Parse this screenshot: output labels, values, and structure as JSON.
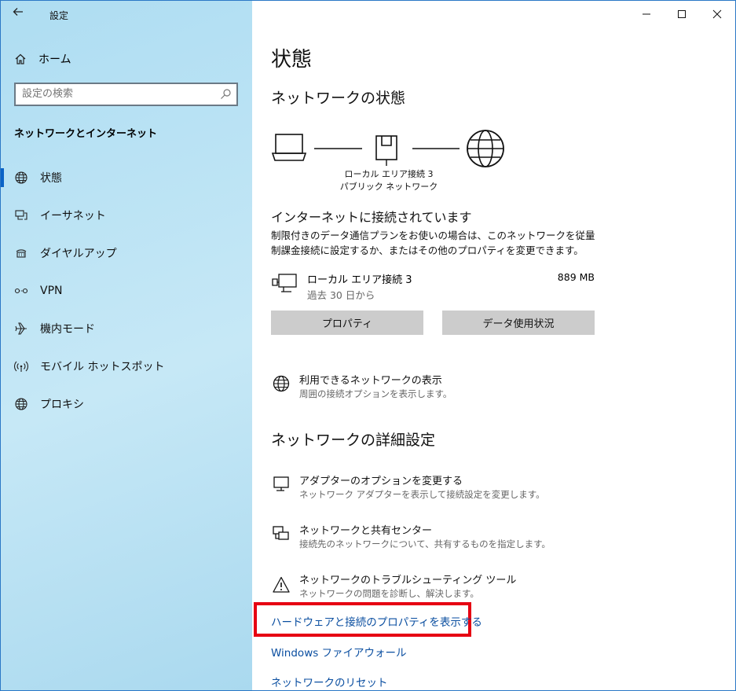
{
  "window": {
    "title": "設定"
  },
  "sidebar": {
    "home_label": "ホーム",
    "search_placeholder": "設定の検索",
    "section_title": "ネットワークとインターネット",
    "items": [
      {
        "label": "状態",
        "icon": "globe-icon",
        "selected": true
      },
      {
        "label": "イーサネット",
        "icon": "ethernet-icon"
      },
      {
        "label": "ダイヤルアップ",
        "icon": "dialup-icon"
      },
      {
        "label": "VPN",
        "icon": "vpn-icon"
      },
      {
        "label": "機内モード",
        "icon": "airplane-icon"
      },
      {
        "label": "モバイル ホットスポット",
        "icon": "hotspot-icon"
      },
      {
        "label": "プロキシ",
        "icon": "globe-icon"
      }
    ]
  },
  "main": {
    "page_title": "状態",
    "network_status_heading": "ネットワークの状態",
    "network_name": "ローカル エリア接続 3",
    "network_type": "パブリック ネットワーク",
    "connected_heading": "インターネットに接続されています",
    "connected_desc": "制限付きのデータ通信プランをお使いの場合は、このネットワークを従量制課金接続に設定するか、またはその他のプロパティを変更できます。",
    "adapter": {
      "name": "ローカル エリア接続 3",
      "since": "過去 30 日から",
      "usage": "889 MB"
    },
    "buttons": {
      "properties": "プロパティ",
      "data_usage": "データ使用状況"
    },
    "show_networks": {
      "title": "利用できるネットワークの表示",
      "desc": "周囲の接続オプションを表示します。"
    },
    "advanced_heading": "ネットワークの詳細設定",
    "advanced_items": [
      {
        "title": "アダプターのオプションを変更する",
        "desc": "ネットワーク アダプターを表示して接続設定を変更します。",
        "icon": "adapter-icon"
      },
      {
        "title": "ネットワークと共有センター",
        "desc": "接続先のネットワークについて、共有するものを指定します。",
        "icon": "sharing-center-icon"
      },
      {
        "title": "ネットワークのトラブルシューティング ツール",
        "desc": "ネットワークの問題を診断し、解決します。",
        "icon": "warning-icon"
      }
    ],
    "links": {
      "hardware_properties": "ハードウェアと接続のプロパティを表示する",
      "firewall": "Windows ファイアウォール",
      "reset": "ネットワークのリセット"
    }
  },
  "colors": {
    "accent": "#0a63c6",
    "link": "#0a4ea0",
    "highlight": "#e60012",
    "sidebar_bg": "#c6e8f6"
  }
}
